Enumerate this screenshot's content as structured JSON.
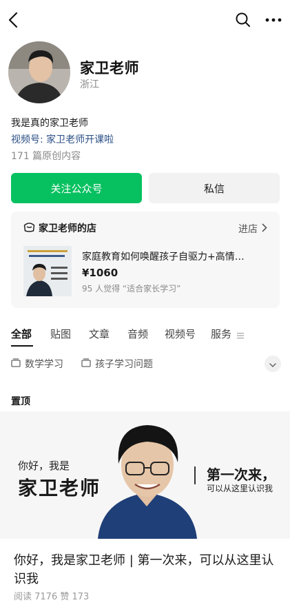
{
  "topbar": {
    "back_icon": "chevron-left-icon",
    "search_icon": "search-icon",
    "more_icon": "more-horizontal-icon"
  },
  "profile": {
    "name": "家卫老师",
    "region": "浙江",
    "bio": "我是真的家卫老师",
    "channel": "视频号: 家卫老师开课啦",
    "original_count": "171 篇原创内容"
  },
  "actions": {
    "follow_label": "关注公众号",
    "message_label": "私信",
    "follow_color": "#07c160"
  },
  "shop": {
    "icon": "shop-icon",
    "title": "家卫老师的店",
    "enter_label": "进店",
    "product": {
      "title": "家庭教育如何唤醒孩子自驱力+高情…",
      "price": "¥1060",
      "subtitle": "95 人觉得 “适合家长学习”"
    }
  },
  "tabs": [
    {
      "label": "全部",
      "active": true
    },
    {
      "label": "贴图",
      "active": false
    },
    {
      "label": "文章",
      "active": false
    },
    {
      "label": "音频",
      "active": false
    },
    {
      "label": "视频号",
      "active": false
    },
    {
      "label": "服务",
      "active": false
    }
  ],
  "filters": [
    {
      "label": "数学学习",
      "icon": "collection-icon"
    },
    {
      "label": "孩子学习问题",
      "icon": "collection-icon"
    }
  ],
  "pinned": {
    "label": "置顶",
    "cover": {
      "hello": "你好，我是",
      "name": "家卫老师",
      "first_time": "第一次来，",
      "know_me": "可以从这里认识我"
    },
    "title": "你好，我是家卫老师 | 第一次来，可以从这里认识我",
    "meta": "阅读 7176  赞 173"
  }
}
